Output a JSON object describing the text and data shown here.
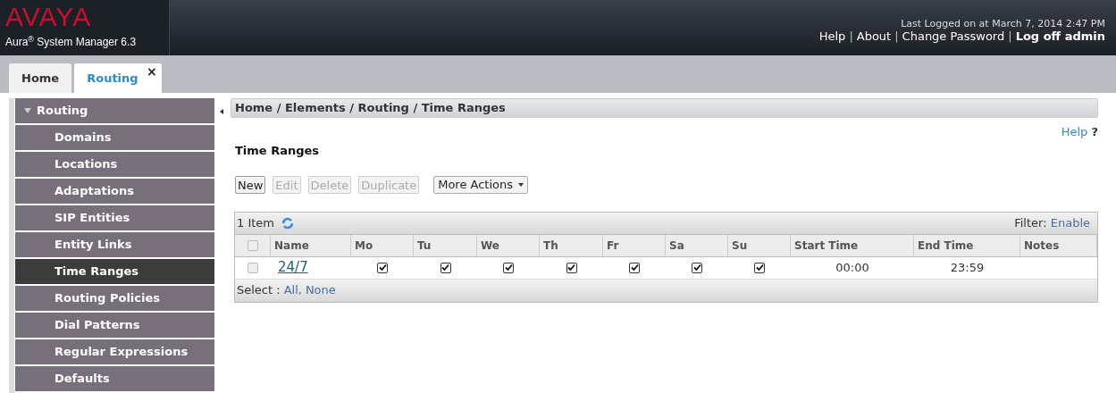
{
  "header": {
    "logo": "AVAYA",
    "product": "Aura$^{®}$ System Manager 6.3",
    "last_login": "Last Logged on at March 7, 2014 2:47 PM",
    "links": [
      {
        "label": "Help",
        "bold": false
      },
      {
        "label": "About",
        "bold": false
      },
      {
        "label": "Change Password",
        "bold": false
      },
      {
        "label": "Log off admin",
        "bold": true
      }
    ],
    "separator": "|"
  },
  "tabs": [
    {
      "label": "Home",
      "selected": false
    },
    {
      "label": "Routing",
      "selected": true,
      "close": "×"
    }
  ],
  "sidebar": {
    "title": "Routing",
    "expanded": true,
    "items": [
      {
        "label": "Domains",
        "selected": false
      },
      {
        "label": "Locations",
        "selected": false
      },
      {
        "label": "Adaptations",
        "selected": false
      },
      {
        "label": "SIP Entities",
        "selected": false
      },
      {
        "label": "Entity Links",
        "selected": false
      },
      {
        "label": "Time Ranges",
        "selected": true
      },
      {
        "label": "Routing Policies",
        "selected": false
      },
      {
        "label": "Dial Patterns",
        "selected": false
      },
      {
        "label": "Regular Expressions",
        "selected": false
      },
      {
        "label": "Defaults",
        "selected": false
      }
    ]
  },
  "breadcrumb": "Home / Elements / Routing / Time Ranges",
  "help": {
    "label": "Help",
    "mark": "?"
  },
  "page_title": "Time Ranges",
  "actions": [
    {
      "label": "New",
      "kind": "button",
      "disabled": false
    },
    {
      "label": "Edit",
      "kind": "button",
      "disabled": true
    },
    {
      "label": "Delete",
      "kind": "button",
      "disabled": true
    },
    {
      "label": "Duplicate",
      "kind": "button",
      "disabled": true
    },
    {
      "label": "More Actions",
      "kind": "dropdown",
      "disabled": false
    }
  ],
  "table": {
    "count": "1 Item",
    "filter_label": "Filter:",
    "filter_link": "Enable",
    "columns": [
      "Name",
      "Mo",
      "Tu",
      "We",
      "Th",
      "Fr",
      "Sa",
      "Su",
      "Start Time",
      "End Time",
      "Notes"
    ],
    "rows": [
      {
        "selected": false,
        "name": "24/7",
        "days": [
          true,
          true,
          true,
          true,
          true,
          true,
          true
        ],
        "start": "00:00",
        "end": "23:59"
      }
    ],
    "select_label": "Select :",
    "select_links": [
      "All",
      "None"
    ],
    "select_separator": ",",
    "all_selected": false
  }
}
